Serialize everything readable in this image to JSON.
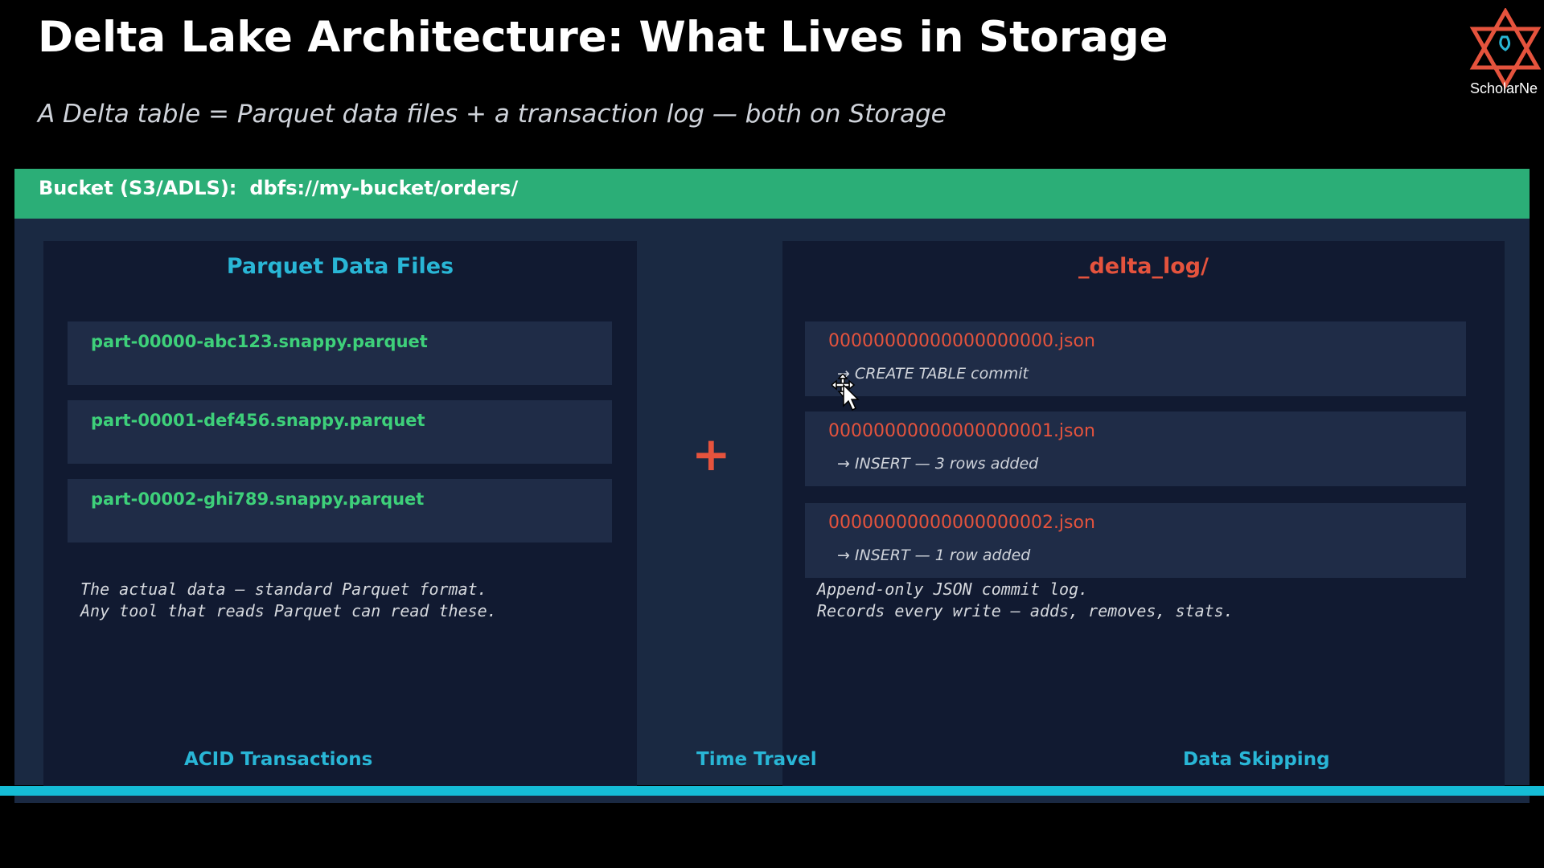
{
  "slide": {
    "title": "Delta Lake Architecture: What Lives in Storage",
    "subtitle": "A Delta table = Parquet data files  +  a transaction log  —  both on Storage"
  },
  "logo": {
    "text": "ScholarNe",
    "icon": "star-of-david-logo-icon"
  },
  "bucket": {
    "label": "Bucket (S3/ADLS):",
    "path": "dbfs://my-bucket/orders/"
  },
  "parquet_panel": {
    "title": "Parquet Data Files",
    "files": [
      "part-00000-abc123.snappy.parquet",
      "part-00001-def456.snappy.parquet",
      "part-00002-ghi789.snappy.parquet"
    ],
    "note_line1": "The actual data — standard Parquet format.",
    "note_line2": "Any tool that reads Parquet can read these."
  },
  "connector": {
    "symbol": "+"
  },
  "log_panel": {
    "title": "_delta_log/",
    "entries": [
      {
        "name": "00000000000000000000.json",
        "arrow": "→",
        "desc": "CREATE TABLE commit"
      },
      {
        "name": "00000000000000000001.json",
        "arrow": "→",
        "desc": "INSERT — 3 rows added"
      },
      {
        "name": "00000000000000000002.json",
        "arrow": "→",
        "desc": "INSERT — 1 row added"
      }
    ],
    "note_line1": "Append-only JSON commit log.",
    "note_line2": "Records every write — adds, removes, stats."
  },
  "features": [
    "ACID Transactions",
    "Time Travel",
    "Data Skipping"
  ],
  "colors": {
    "background": "#000000",
    "bucket_bar": "#2bae77",
    "stage": "#1a2942",
    "panel": "#111a31",
    "card": "#1f2c47",
    "parquet_accent": "#29b6d6",
    "log_accent": "#e5533d",
    "file_green": "#3ed07a",
    "bottom_line": "#15bcd6"
  },
  "cursor": {
    "icon": "move-cursor-icon"
  }
}
